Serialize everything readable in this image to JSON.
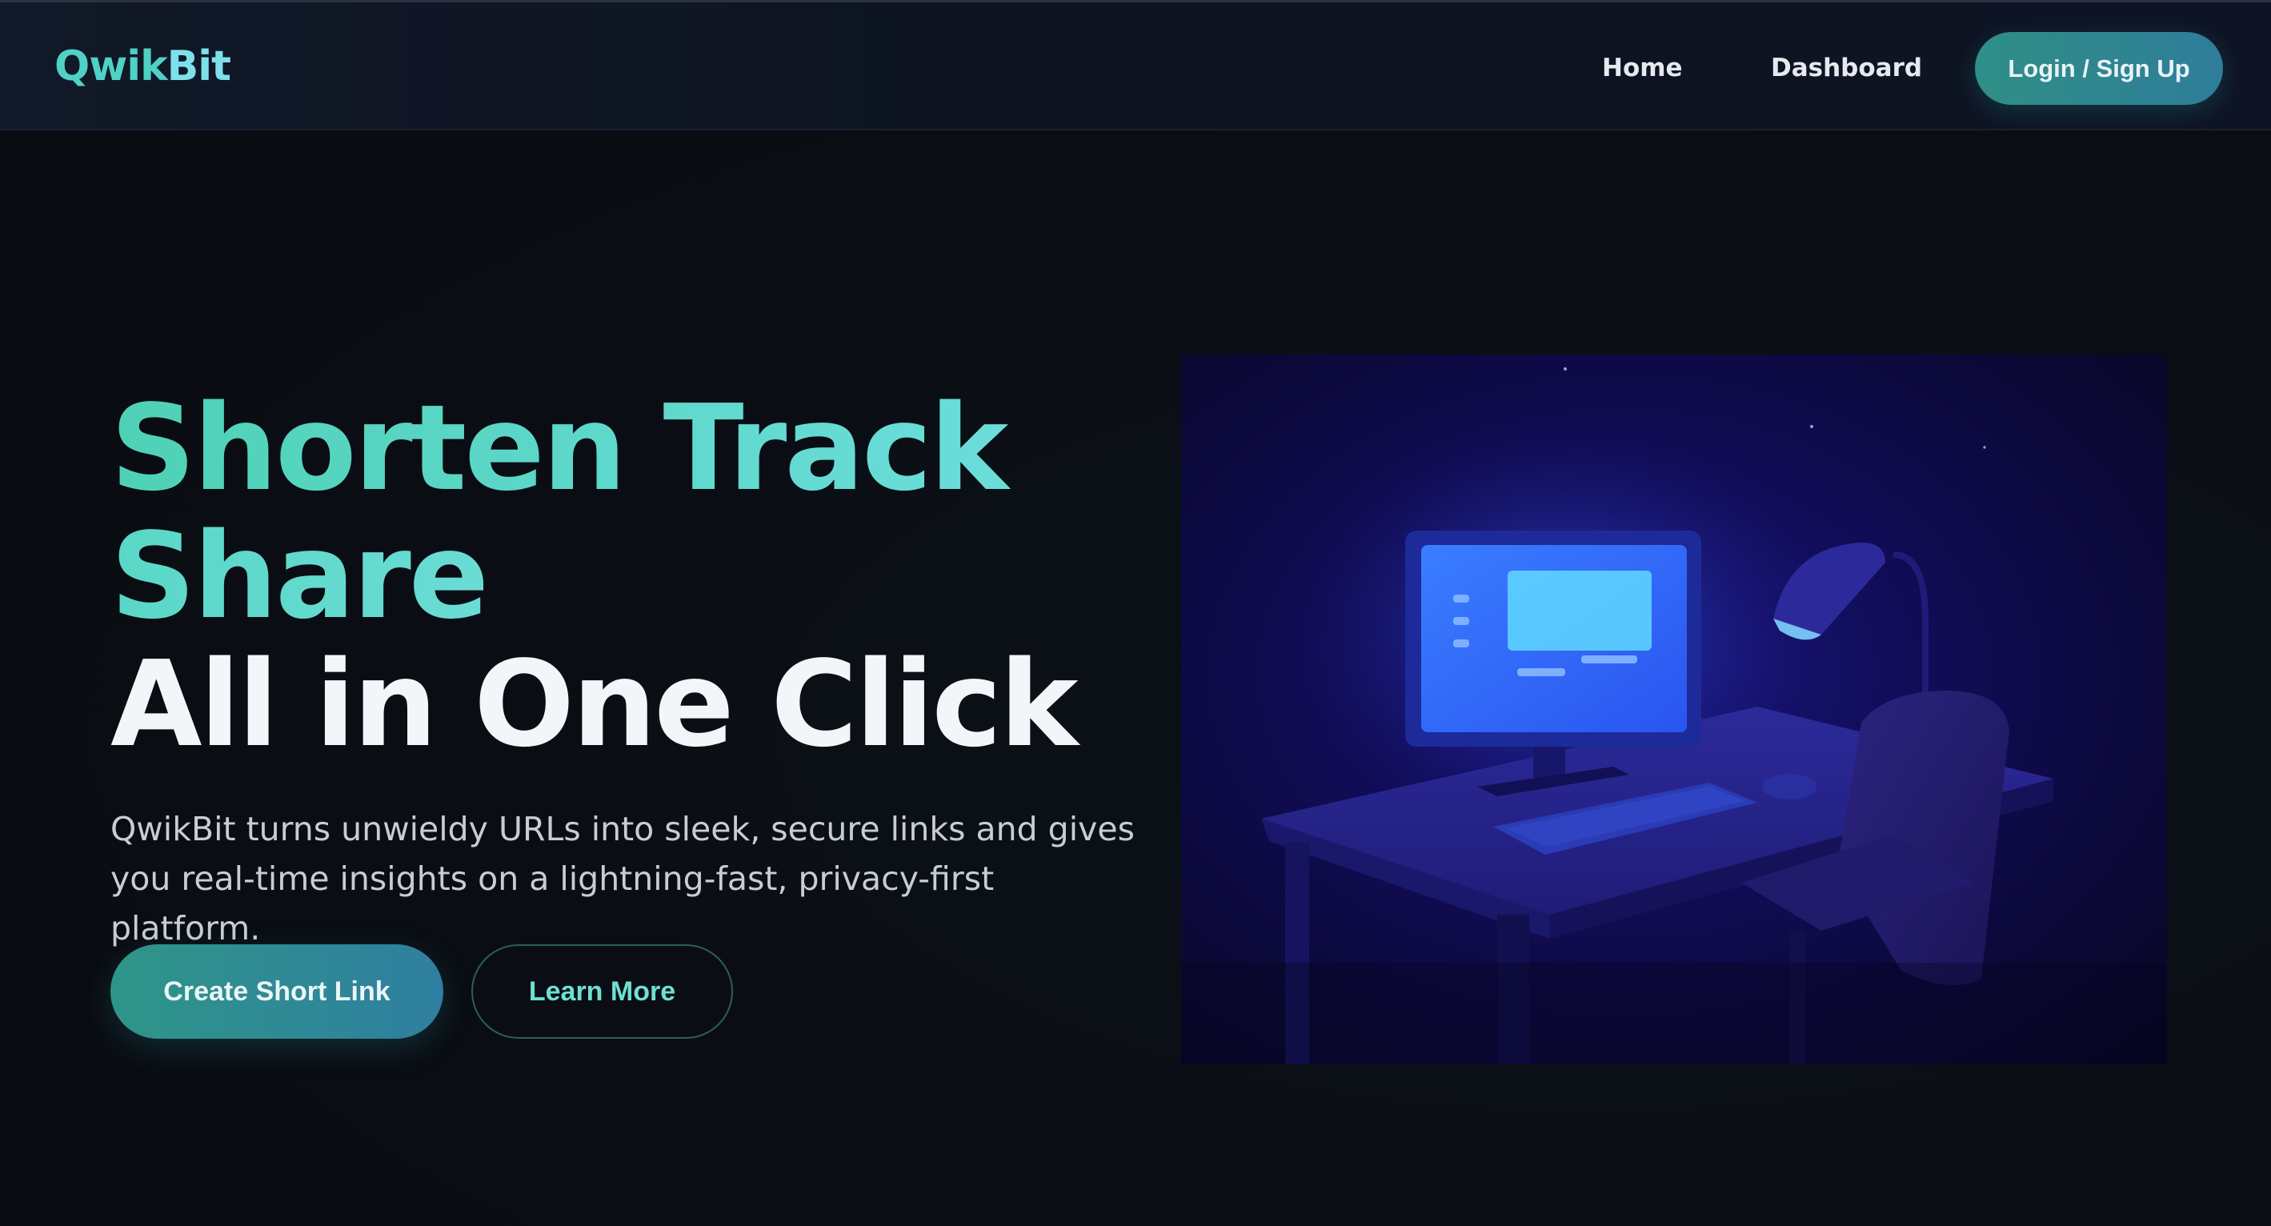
{
  "navbar": {
    "brand_part1": "Qwik",
    "brand_part2": "Bit",
    "links": [
      {
        "label": "Home"
      },
      {
        "label": "Dashboard"
      }
    ],
    "cta_label": "Login / Sign Up"
  },
  "hero": {
    "heading_line1": "Shorten Track",
    "heading_line2": "Share",
    "heading_line3": "All in One Click",
    "description": "QwikBit turns unwieldy URLs into sleek, secure links and gives you real-time insights on a lightning-fast, privacy-first platform.",
    "primary_button": "Create Short Link",
    "secondary_button": "Learn More"
  },
  "illustration": {
    "icons": [
      "monitor-icon",
      "desk-lamp-icon",
      "keyboard-icon",
      "mouse-icon",
      "chair-icon",
      "desk-icon"
    ]
  },
  "colors": {
    "background": "#0b0f16",
    "accent_teal": "#4fd1c5",
    "accent_cyan": "#7ee0ea",
    "button_gradient_start": "#2f9588",
    "button_gradient_end": "#2f7fa0",
    "illustration_indigo": "#1a1680"
  }
}
